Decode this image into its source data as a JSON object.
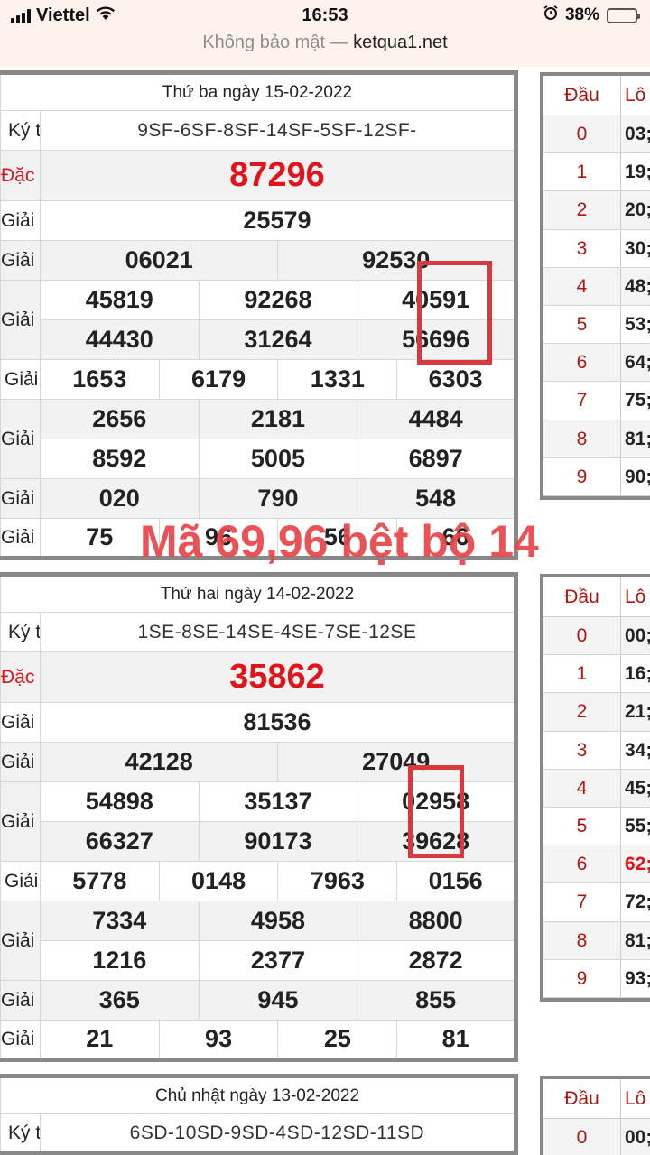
{
  "status_bar": {
    "carrier": "Viettel",
    "time": "16:53",
    "battery": "38%",
    "battery_level": 0.38
  },
  "url_bar": {
    "insecure_label": "Không bảo mật —",
    "domain": "ketqua1.net"
  },
  "labels": {
    "ky_tu": "Ký tự",
    "dac_biet": "Đặc biệt",
    "giai_nhat": "Giải nhất",
    "giai_nhi": "Giải nhì",
    "giai_ba": "Giải ba",
    "giai_tu": "Giải tư",
    "giai_nam": "Giải năm",
    "giai_sau": "Giải sáu",
    "giai_bay": "Giải bảy",
    "dau": "Đầu",
    "lo": "Lô"
  },
  "results": [
    {
      "date": "Thứ ba ngày 15-02-2022",
      "codes": "9SF-6SF-8SF-14SF-5SF-12SF-",
      "dac_biet": "87296",
      "giai_nhat": "25579",
      "giai_nhi": [
        "06021",
        "92530"
      ],
      "giai_ba": [
        "45819",
        "92268",
        "40591",
        "44430",
        "31264",
        "56696"
      ],
      "giai_tu": [
        "1653",
        "6179",
        "1331",
        "6303"
      ],
      "giai_nam": [
        "2656",
        "2181",
        "4484",
        "8592",
        "5005",
        "6897"
      ],
      "giai_sau": [
        "020",
        "790",
        "548"
      ],
      "giai_bay": [
        "75",
        "96",
        "56",
        "66"
      ],
      "loto": [
        {
          "dau": "0",
          "lo": "03;"
        },
        {
          "dau": "1",
          "lo": "19;"
        },
        {
          "dau": "2",
          "lo": "20;"
        },
        {
          "dau": "3",
          "lo": "30;"
        },
        {
          "dau": "4",
          "lo": "48;"
        },
        {
          "dau": "5",
          "lo": "53;"
        },
        {
          "dau": "6",
          "lo": "64;"
        },
        {
          "dau": "7",
          "lo": "75;"
        },
        {
          "dau": "8",
          "lo": "81;"
        },
        {
          "dau": "9",
          "lo": "90;"
        }
      ]
    },
    {
      "date": "Thứ hai ngày 14-02-2022",
      "codes": "1SE-8SE-14SE-4SE-7SE-12SE",
      "dac_biet": "35862",
      "giai_nhat": "81536",
      "giai_nhi": [
        "42128",
        "27049"
      ],
      "giai_ba": [
        "54898",
        "35137",
        "02958",
        "66327",
        "90173",
        "39628"
      ],
      "giai_tu": [
        "5778",
        "0148",
        "7963",
        "0156"
      ],
      "giai_nam": [
        "7334",
        "4958",
        "8800",
        "1216",
        "2377",
        "2872"
      ],
      "giai_sau": [
        "365",
        "945",
        "855"
      ],
      "giai_bay": [
        "21",
        "93",
        "25",
        "81"
      ],
      "loto": [
        {
          "dau": "0",
          "lo": "00;"
        },
        {
          "dau": "1",
          "lo": "16;"
        },
        {
          "dau": "2",
          "lo": "21;"
        },
        {
          "dau": "3",
          "lo": "34;"
        },
        {
          "dau": "4",
          "lo": "45;"
        },
        {
          "dau": "5",
          "lo": "55;"
        },
        {
          "dau": "6",
          "lo": "62;"
        },
        {
          "dau": "7",
          "lo": "72;"
        },
        {
          "dau": "8",
          "lo": "81;"
        },
        {
          "dau": "9",
          "lo": "93;"
        }
      ]
    },
    {
      "date": "Chủ nhật ngày 13-02-2022",
      "codes": "6SD-10SD-9SD-4SD-12SD-11SD",
      "loto": [
        {
          "dau": "0",
          "lo": "00;"
        }
      ]
    }
  ],
  "annotation": {
    "overlay_text": "Mã 69,96 bệt bộ 14",
    "color": "#e8464b"
  }
}
